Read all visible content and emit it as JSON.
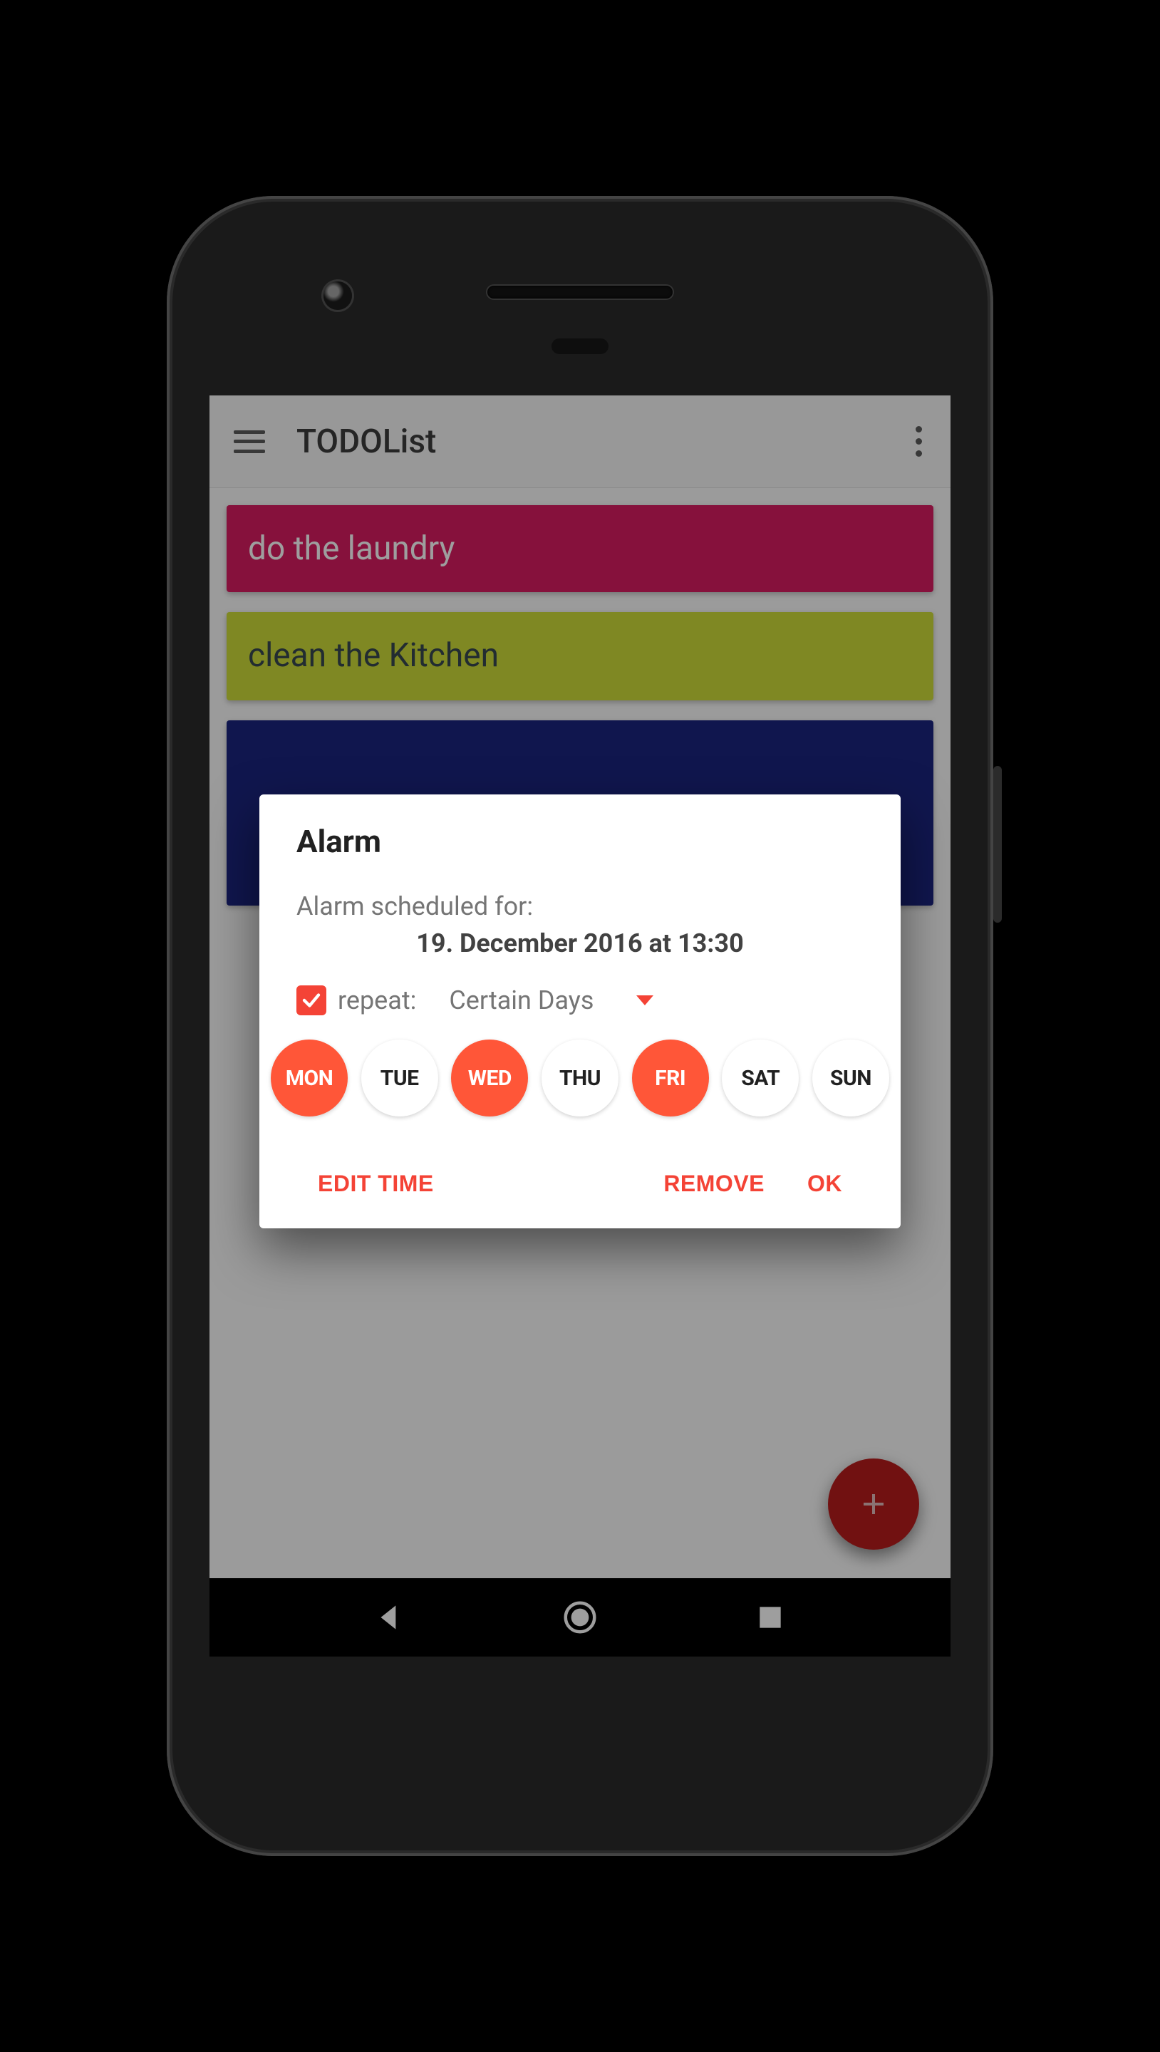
{
  "appbar": {
    "title": "TODOList"
  },
  "tasks": [
    {
      "label": "do the laundry",
      "color": "pink"
    },
    {
      "label": "clean the Kitchen",
      "color": "yellow"
    },
    {
      "label": "",
      "color": "blue"
    }
  ],
  "dialog": {
    "title": "Alarm",
    "scheduled_label": "Alarm scheduled for:",
    "scheduled_value": "19. December 2016 at 13:30",
    "repeat_checked": true,
    "repeat_label": "repeat:",
    "repeat_mode": "Certain Days",
    "days": [
      {
        "abbr": "MON",
        "selected": true
      },
      {
        "abbr": "TUE",
        "selected": false
      },
      {
        "abbr": "WED",
        "selected": true
      },
      {
        "abbr": "THU",
        "selected": false
      },
      {
        "abbr": "FRI",
        "selected": true
      },
      {
        "abbr": "SAT",
        "selected": false
      },
      {
        "abbr": "SUN",
        "selected": false
      }
    ],
    "actions": {
      "edit_time": "EDIT TIME",
      "remove": "REMOVE",
      "ok": "OK"
    }
  },
  "colors": {
    "accent": "#f44336",
    "day_selected": "#ff5638",
    "fab": "#b71c1c"
  }
}
